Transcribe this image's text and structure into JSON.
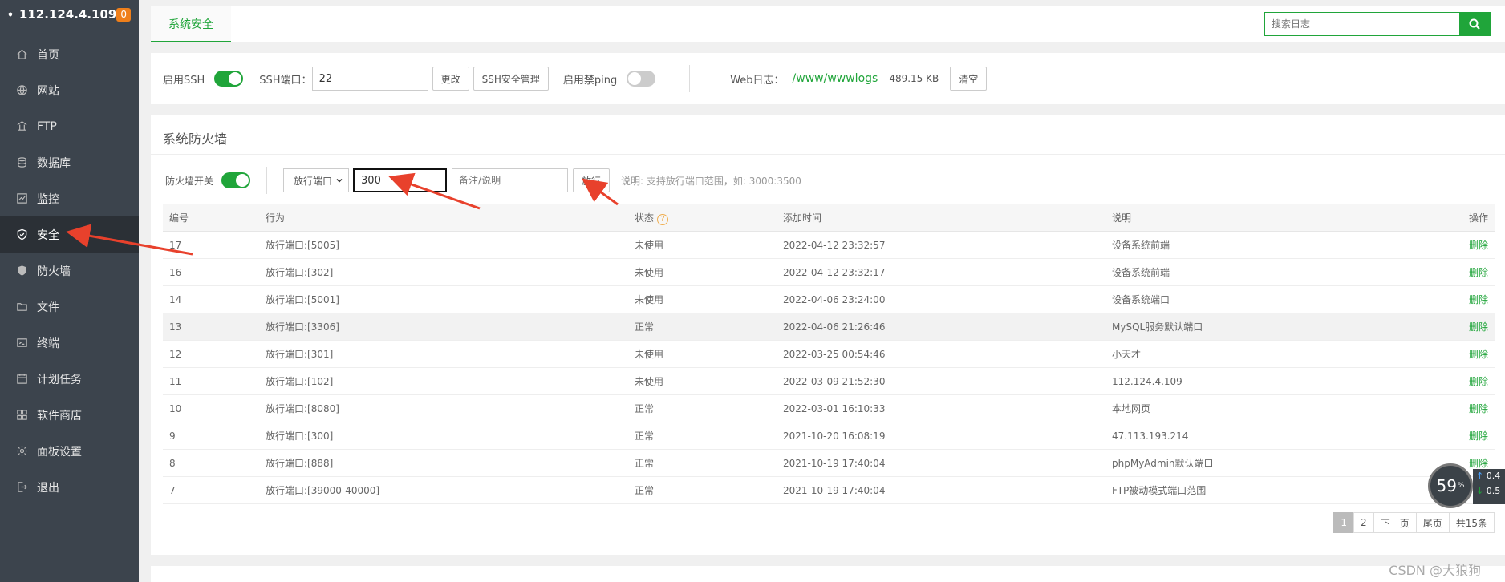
{
  "sidebar": {
    "ip": "112.124.4.109",
    "badge": "0",
    "items": [
      {
        "label": "首页",
        "icon": "home-icon"
      },
      {
        "label": "网站",
        "icon": "globe-icon"
      },
      {
        "label": "FTP",
        "icon": "ftp-icon"
      },
      {
        "label": "数据库",
        "icon": "database-icon"
      },
      {
        "label": "监控",
        "icon": "monitor-icon"
      },
      {
        "label": "安全",
        "icon": "shield-check-icon"
      },
      {
        "label": "防火墙",
        "icon": "firewall-icon"
      },
      {
        "label": "文件",
        "icon": "folder-icon"
      },
      {
        "label": "终端",
        "icon": "terminal-icon"
      },
      {
        "label": "计划任务",
        "icon": "calendar-icon"
      },
      {
        "label": "软件商店",
        "icon": "apps-icon"
      },
      {
        "label": "面板设置",
        "icon": "gear-icon"
      },
      {
        "label": "退出",
        "icon": "logout-icon"
      }
    ]
  },
  "tabbar": {
    "tab": "系统安全",
    "search_placeholder": "搜索日志"
  },
  "ssh": {
    "enable_label": "启用SSH",
    "port_label": "SSH端口：",
    "port_value": "22",
    "change_btn": "更改",
    "manage_btn": "SSH安全管理",
    "ping_label": "启用禁ping",
    "weblog_label": "Web日志：",
    "weblog_path": "/www/wwwlogs",
    "weblog_size": "489.15 KB",
    "clear_btn": "清空"
  },
  "firewall": {
    "title": "系统防火墙",
    "switch_label": "防火墙开关",
    "select_value": "放行端口",
    "port_input_value": "300",
    "note_placeholder": "备注/说明",
    "release_btn": "放行",
    "hint": "说明: 支持放行端口范围，如: 3000:3500",
    "columns": [
      "编号",
      "行为",
      "状态",
      "添加时间",
      "说明",
      "操作"
    ],
    "rows": [
      {
        "id": "17",
        "action": "放行端口:[5005]",
        "status": "未使用",
        "time": "2022-04-12 23:32:57",
        "note": "设备系统前端",
        "op": "删除"
      },
      {
        "id": "16",
        "action": "放行端口:[302]",
        "status": "未使用",
        "time": "2022-04-12 23:32:17",
        "note": "设备系统前端",
        "op": "删除"
      },
      {
        "id": "14",
        "action": "放行端口:[5001]",
        "status": "未使用",
        "time": "2022-04-06 23:24:00",
        "note": "设备系统端口",
        "op": "删除"
      },
      {
        "id": "13",
        "action": "放行端口:[3306]",
        "status": "正常",
        "time": "2022-04-06 21:26:46",
        "note": "MySQL服务默认端口",
        "op": "删除"
      },
      {
        "id": "12",
        "action": "放行端口:[301]",
        "status": "未使用",
        "time": "2022-03-25 00:54:46",
        "note": "小天才",
        "op": "删除"
      },
      {
        "id": "11",
        "action": "放行端口:[102]",
        "status": "未使用",
        "time": "2022-03-09 21:52:30",
        "note": "112.124.4.109",
        "op": "删除"
      },
      {
        "id": "10",
        "action": "放行端口:[8080]",
        "status": "正常",
        "time": "2022-03-01 16:10:33",
        "note": "本地网页",
        "op": "删除"
      },
      {
        "id": "9",
        "action": "放行端口:[300]",
        "status": "正常",
        "time": "2021-10-20 16:08:19",
        "note": "47.113.193.214",
        "op": "删除"
      },
      {
        "id": "8",
        "action": "放行端口:[888]",
        "status": "正常",
        "time": "2021-10-19 17:40:04",
        "note": "phpMyAdmin默认端口",
        "op": "删除"
      },
      {
        "id": "7",
        "action": "放行端口:[39000-40000]",
        "status": "正常",
        "time": "2021-10-19 17:40:04",
        "note": "FTP被动模式端口范围",
        "op": ""
      }
    ],
    "pager": {
      "p1": "1",
      "p2": "2",
      "next": "下一页",
      "last": "尾页",
      "total": "共15条"
    }
  },
  "gauge": {
    "value": "59",
    "unit": "%",
    "up": "0.4",
    "down": "0.5"
  },
  "watermark": "CSDN @大狼狗",
  "colors": {
    "accent": "#20a53a",
    "sidebar": "#3c444d",
    "arrow": "#e8412c"
  }
}
